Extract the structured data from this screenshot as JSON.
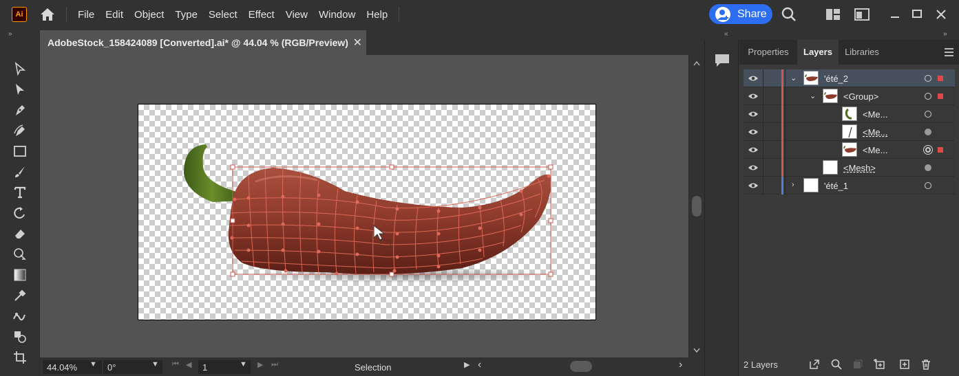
{
  "app": {
    "logo_text": "Ai"
  },
  "menu": {
    "items": [
      "File",
      "Edit",
      "Object",
      "Type",
      "Select",
      "Effect",
      "View",
      "Window",
      "Help"
    ]
  },
  "share": {
    "label": "Share"
  },
  "document": {
    "tab_title": "AdobeStock_158424089 [Converted].ai* @ 44.04 % (RGB/Preview)",
    "close": "✕"
  },
  "toolbar": {
    "tools": [
      "selection-tool",
      "direct-selection-tool",
      "pen-tool",
      "curvature-tool",
      "rectangle-tool",
      "paintbrush-tool",
      "type-tool",
      "rotate-tool",
      "eraser-tool",
      "shape-builder-tool",
      "gradient-tool",
      "eyedropper-tool",
      "puppet-warp-tool",
      "blend-tool",
      "artboard-tool"
    ]
  },
  "status": {
    "zoom": "44.04%",
    "rotation": "0°",
    "artboard_number": "1",
    "tool_name": "Selection"
  },
  "panel": {
    "tabs": [
      "Properties",
      "Layers",
      "Libraries"
    ],
    "active_tab": "Layers",
    "layers": [
      {
        "name": "'été_2",
        "indent": 0,
        "twisty": "open",
        "selected": true,
        "bar": "#d0584f",
        "target": "ring",
        "square": true,
        "thumb": "pepper"
      },
      {
        "name": "<Group>",
        "indent": 1,
        "twisty": "open",
        "selected": false,
        "bar": "#d0584f",
        "target": "ring",
        "square": true,
        "thumb": "pepper"
      },
      {
        "name": "<Me...",
        "indent": 2,
        "twisty": "none",
        "selected": false,
        "bar": "#d0584f",
        "target": "ring",
        "square": false,
        "thumb": "stem"
      },
      {
        "name": "<Me...",
        "indent": 2,
        "twisty": "none",
        "selected": false,
        "bar": "#d0584f",
        "target": "filled",
        "square": false,
        "thumb": "line",
        "underline": true
      },
      {
        "name": "<Me...",
        "indent": 2,
        "twisty": "none",
        "selected": false,
        "bar": "#d0584f",
        "target": "double",
        "square": true,
        "thumb": "pepper"
      },
      {
        "name": "<Mesh>",
        "indent": 1,
        "twisty": "none",
        "selected": false,
        "bar": "#d0584f",
        "target": "filled",
        "square": false,
        "thumb": "blank",
        "underline": true
      },
      {
        "name": "'été_1",
        "indent": 0,
        "twisty": "closed",
        "selected": false,
        "bar": "#4f7ed8",
        "target": "ring",
        "square": false,
        "thumb": "blank"
      }
    ],
    "footer": {
      "count": "2 Layers"
    }
  },
  "colors": {
    "accent": "#2c6df2",
    "selection": "#d0584f",
    "pepper": "#8f3b2c",
    "stem": "#4d6b1f"
  }
}
